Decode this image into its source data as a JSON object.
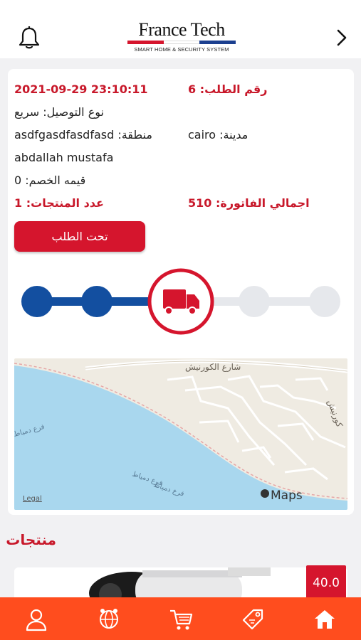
{
  "header": {
    "logo_title": "France Tech",
    "logo_subtitle": "SMART HOME & SECURITY SYSTEM",
    "icons": {
      "left": "bell-icon",
      "right": "chevron-right-icon"
    },
    "logo_colors": [
      "#d5152d",
      "#1b3f8f",
      "#ffffff"
    ]
  },
  "order": {
    "order_number": "رقم الطلب: 6",
    "date": "2021-09-29 23:10:11",
    "delivery_type": "نوع التوصيل: سريع",
    "city": "مدينة: cairo",
    "area": "منطقة: asdfgasdfasdfasd",
    "customer": "abdallah mustafa",
    "discount": "قيمه الخصم: 0",
    "invoice_total": "اجمالي الفاتورة: 510",
    "products_count": "عدد المنتجات: 1",
    "status_button": "تحت الطلب"
  },
  "tracking": {
    "steps_total": 5,
    "current_step": 3,
    "current_icon": "truck-icon",
    "active_color": "#134fa0",
    "inactive_color": "#e6e8ec",
    "accent": "#d5152d"
  },
  "map": {
    "street_label": "شارع الكورنيش",
    "street_label_right": "كورنيش",
    "river_label_1": "فرع دمياط",
    "river_label_2": "فرع دمياط",
    "river_label_3": "فرع دمياط",
    "maps_brand": "Maps",
    "legal": "Legal"
  },
  "products_section": {
    "title": "منتجات",
    "items": [
      {
        "price": "40.0",
        "image": "security-camera"
      }
    ]
  },
  "bottom_nav": {
    "background": "#ff4d1e",
    "items": [
      "profile-icon",
      "globe-icon",
      "cart-icon",
      "tag-icon",
      "home-icon"
    ]
  }
}
